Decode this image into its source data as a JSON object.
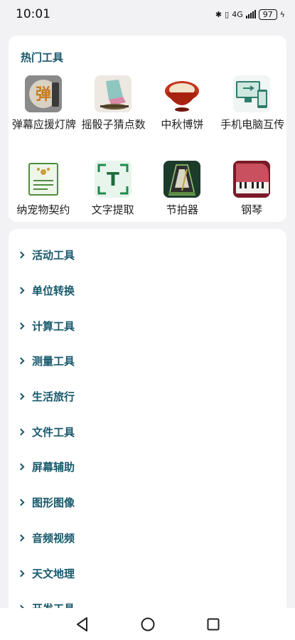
{
  "status": {
    "time": "10:01",
    "network": "4G",
    "battery": "97"
  },
  "hot_tools": {
    "title": "热门工具",
    "items": [
      {
        "label": "弹幕应援灯牌",
        "icon": "danmaku-sign-icon",
        "glyph": "弹"
      },
      {
        "label": "摇骰子猜点数",
        "icon": "dice-cup-icon"
      },
      {
        "label": "中秋博饼",
        "icon": "mooncake-bowl-icon"
      },
      {
        "label": "手机电脑互传",
        "icon": "phone-pc-transfer-icon"
      },
      {
        "label": "纳宠物契约",
        "icon": "pet-contract-icon"
      },
      {
        "label": "文字提取",
        "icon": "text-scan-icon",
        "glyph": "T"
      },
      {
        "label": "节拍器",
        "icon": "metronome-icon"
      },
      {
        "label": "钢琴",
        "icon": "piano-icon"
      }
    ]
  },
  "categories": [
    {
      "label": "活动工具"
    },
    {
      "label": "单位转换"
    },
    {
      "label": "计算工具"
    },
    {
      "label": "测量工具"
    },
    {
      "label": "生活旅行"
    },
    {
      "label": "文件工具"
    },
    {
      "label": "屏幕辅助"
    },
    {
      "label": "图形图像"
    },
    {
      "label": "音频视频"
    },
    {
      "label": "天文地理"
    },
    {
      "label": "开发工具"
    }
  ],
  "colors": {
    "accent": "#16586b",
    "background": "#f2f2f4"
  }
}
